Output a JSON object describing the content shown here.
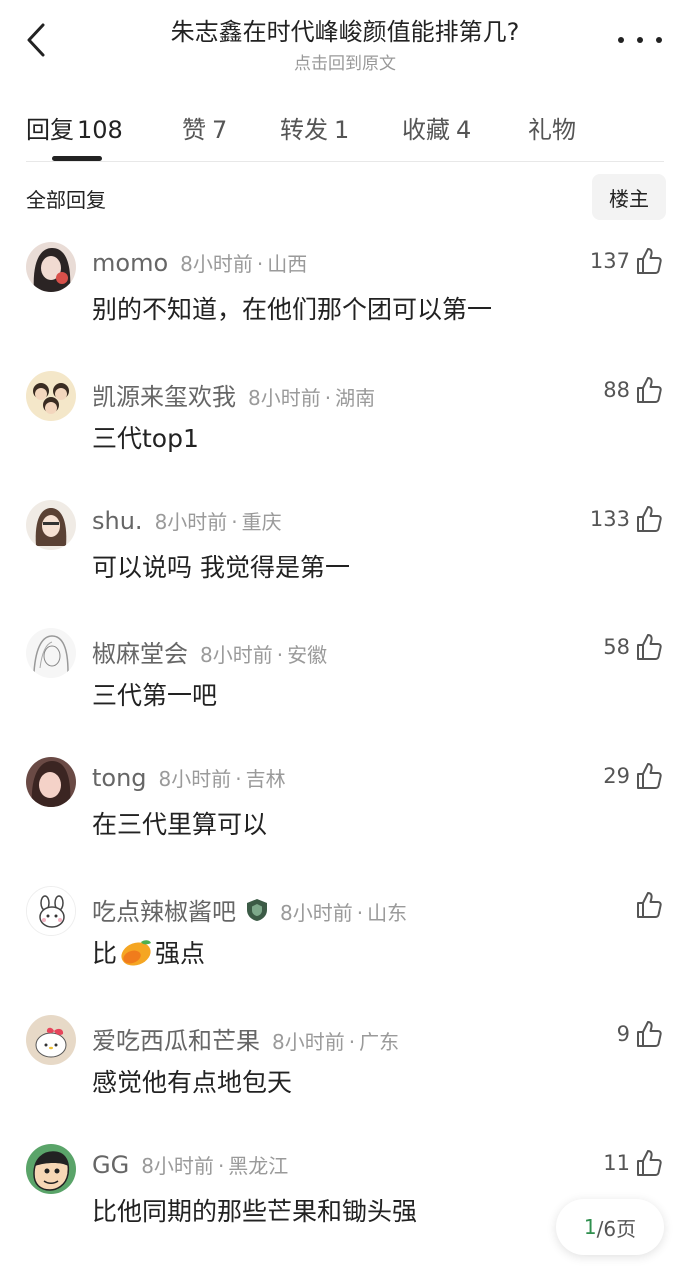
{
  "header": {
    "title": "朱志鑫在时代峰峻颜值能排第几?",
    "subtitle": "点击回到原文"
  },
  "tabs": [
    {
      "label": "回复",
      "count": "108"
    },
    {
      "label": "赞",
      "count": "7"
    },
    {
      "label": "转发",
      "count": "1"
    },
    {
      "label": "收藏",
      "count": "4"
    },
    {
      "label": "礼物",
      "count": ""
    }
  ],
  "filter": {
    "label": "全部回复",
    "owner_button": "楼主"
  },
  "comments": [
    {
      "name": "momo",
      "time": "8小时前",
      "location": "山西",
      "text": "别的不知道，在他们那个团可以第一",
      "likes": "137"
    },
    {
      "name": "凯源来玺欢我",
      "time": "8小时前",
      "location": "湖南",
      "text": "三代top1",
      "likes": "88"
    },
    {
      "name": "shu.",
      "time": "8小时前",
      "location": "重庆",
      "text": "可以说吗 我觉得是第一",
      "likes": "133"
    },
    {
      "name": "椒麻堂会",
      "time": "8小时前",
      "location": "安徽",
      "text": "三代第一吧",
      "likes": "58"
    },
    {
      "name": "tong",
      "time": "8小时前",
      "location": "吉林",
      "text": "在三代里算可以",
      "likes": "29"
    },
    {
      "name": "吃点辣椒酱吧",
      "time": "8小时前",
      "location": "山东",
      "text_before": "比",
      "emoji": "mango-emoji",
      "text_after": "强点",
      "likes": ""
    },
    {
      "name": "爱吃西瓜和芒果",
      "time": "8小时前",
      "location": "广东",
      "text": "感觉他有点地包天",
      "likes": "9"
    },
    {
      "name": "GG",
      "time": "8小时前",
      "location": "黑龙江",
      "text": "比他同期的那些芒果和锄头强",
      "likes": "11"
    }
  ],
  "pager": {
    "current": "1",
    "rest": "/6页"
  },
  "colors": {
    "accent_green": "#2f8f4e",
    "text_primary": "#222222",
    "text_secondary": "#999999"
  }
}
